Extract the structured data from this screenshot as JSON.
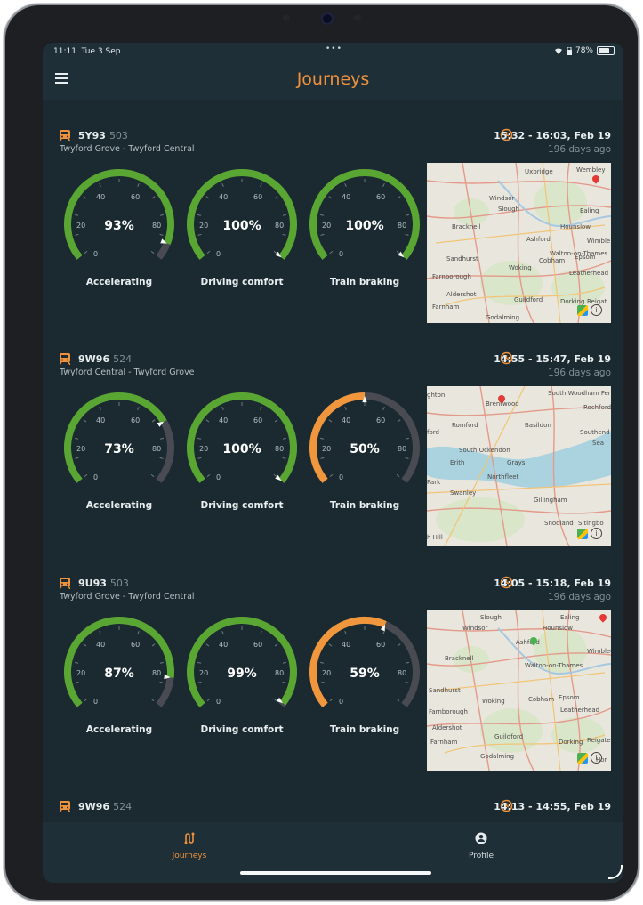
{
  "status": {
    "time": "11:11",
    "date": "Tue 3 Sep",
    "battery": "78%",
    "battery_level": 0.78
  },
  "header": {
    "title": "Journeys"
  },
  "colors": {
    "accent": "#f0913c",
    "green": "#5aa632",
    "orange": "#f0963c",
    "grey": "#4a4a52",
    "background": "#1a2a30",
    "bar": "#1e2f37"
  },
  "gauge_ticks": [
    "0",
    "20",
    "40",
    "60",
    "80"
  ],
  "journeys": [
    {
      "code": "5Y93",
      "unit": "503",
      "route": "Twyford Grove - Twyford Central",
      "time_range": "15:32 - 16:03, Feb 19",
      "ago": "196 days ago",
      "gauges": [
        {
          "label": "Accelerating",
          "value_text": "93%",
          "value": 93,
          "color": "#5aa632"
        },
        {
          "label": "Driving comfort",
          "value_text": "100%",
          "value": 100,
          "color": "#5aa632"
        },
        {
          "label": "Train braking",
          "value_text": "100%",
          "value": 100,
          "color": "#5aa632"
        }
      ],
      "map_places": [
        "Uxbridge",
        "Wembley",
        "Slough",
        "Ealing",
        "Windsor",
        "Hounslow",
        "Bracknell",
        "Ashford",
        "Walton-on-Thames",
        "Wimble",
        "Sandhurst",
        "Woking",
        "Cobham",
        "Epsom",
        "Leatherhead",
        "Farnborough",
        "Aldershot",
        "Guildford",
        "Farnham",
        "Godalming",
        "Dorking",
        "Reigat"
      ]
    },
    {
      "code": "9W96",
      "unit": "524",
      "route": "Twyford Central - Twyford Grove",
      "time_range": "14:55 - 15:47, Feb 19",
      "ago": "196 days ago",
      "gauges": [
        {
          "label": "Accelerating",
          "value_text": "73%",
          "value": 73,
          "color": "#5aa632"
        },
        {
          "label": "Driving comfort",
          "value_text": "100%",
          "value": 100,
          "color": "#5aa632"
        },
        {
          "label": "Train braking",
          "value_text": "50%",
          "value": 50,
          "color": "#f0963c"
        }
      ],
      "map_places": [
        "ghton",
        "South Woodham Ferrers",
        "Brentwood",
        "Rochford",
        "Romford",
        "Basildon",
        "Southend",
        "ford",
        "Sea",
        "South Ockendon",
        "Erith",
        "Grays",
        "Northfleet",
        "Park",
        "Swanley",
        "Gillingham",
        "Snodland",
        "Sitingbo",
        "h Hill"
      ]
    },
    {
      "code": "9U93",
      "unit": "503",
      "route": "Twyford Grove - Twyford Central",
      "time_range": "14:05 - 15:18, Feb 19",
      "ago": "196 days ago",
      "gauges": [
        {
          "label": "Accelerating",
          "value_text": "87%",
          "value": 87,
          "color": "#5aa632"
        },
        {
          "label": "Driving comfort",
          "value_text": "99%",
          "value": 99,
          "color": "#5aa632"
        },
        {
          "label": "Train braking",
          "value_text": "59%",
          "value": 59,
          "color": "#f0963c"
        }
      ],
      "map_places": [
        "Slough",
        "Ealing",
        "Windsor",
        "Hounslow",
        "Bracknell",
        "Ashford",
        "Wimbledo",
        "Walton-on-Thames",
        "Sandhurst",
        "Woking",
        "Cobham",
        "Epsom",
        "Farnborough",
        "Leatherhead",
        "Aldershot",
        "Guildford",
        "Dorking",
        "Reigate",
        "Farnham",
        "Godalming",
        "Hor"
      ]
    }
  ],
  "partial_journey": {
    "code": "9W96",
    "unit": "524",
    "time_range": "14:13 - 14:55, Feb 19"
  },
  "tabs": [
    {
      "label": "Journeys",
      "icon": "route-icon",
      "active": true
    },
    {
      "label": "Profile",
      "icon": "user-icon",
      "active": false
    }
  ]
}
